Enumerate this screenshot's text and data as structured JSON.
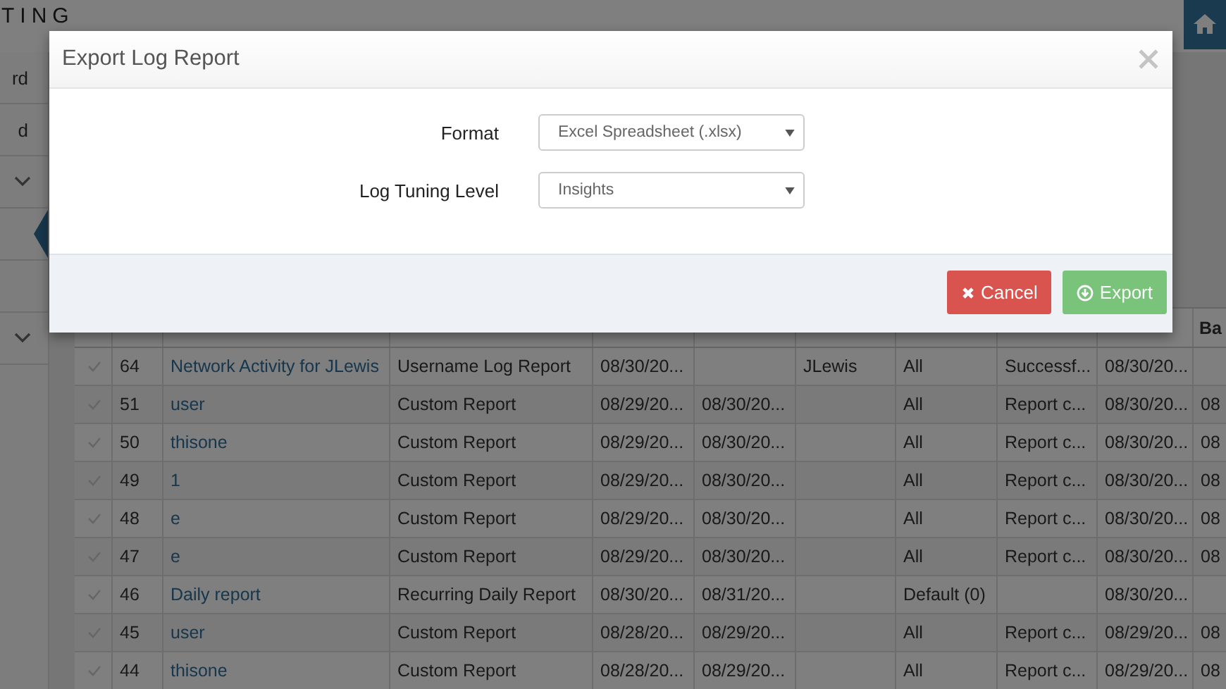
{
  "page_heading": "TING",
  "sidebar": {
    "items": [
      {
        "kind": "text",
        "label": "rd"
      },
      {
        "kind": "text",
        "label": "d"
      },
      {
        "kind": "chevron"
      },
      {
        "kind": "pointer"
      },
      {
        "kind": "blank"
      },
      {
        "kind": "chevron"
      }
    ]
  },
  "table": {
    "header_fragment": "Ba",
    "rows": [
      {
        "column_2": "64",
        "column_3": "Network Activity for JLewis",
        "column_4": "Username Log Report",
        "column_5": "08/30/20...",
        "column_7": "JLewis",
        "column_8": "All",
        "column_9": "Successf...",
        "column_10": "08/30/20..."
      },
      {
        "column_2": "51",
        "column_3": "user",
        "column_4": "Custom Report",
        "column_5": "08/29/20...",
        "column_6": "08/30/20...",
        "column_8": "All",
        "column_9": "Report c...",
        "column_10": "08/30/20...",
        "column_11": "08"
      },
      {
        "column_2": "50",
        "column_3": "thisone",
        "column_4": "Custom Report",
        "column_5": "08/29/20...",
        "column_6": "08/30/20...",
        "column_8": "All",
        "column_9": "Report c...",
        "column_10": "08/30/20...",
        "column_11": "08"
      },
      {
        "column_2": "49",
        "column_3": "1",
        "column_4": "Custom Report",
        "column_5": "08/29/20...",
        "column_6": "08/30/20...",
        "column_8": "All",
        "column_9": "Report c...",
        "column_10": "08/30/20...",
        "column_11": "08"
      },
      {
        "column_2": "48",
        "column_3": "e",
        "column_4": "Custom Report",
        "column_5": "08/29/20...",
        "column_6": "08/30/20...",
        "column_8": "All",
        "column_9": "Report c...",
        "column_10": "08/30/20...",
        "column_11": "08"
      },
      {
        "column_2": "47",
        "column_3": "e",
        "column_4": "Custom Report",
        "column_5": "08/29/20...",
        "column_6": "08/30/20...",
        "column_8": "All",
        "column_9": "Report c...",
        "column_10": "08/30/20...",
        "column_11": "08"
      },
      {
        "column_2": "46",
        "column_3": "Daily report",
        "column_4": "Recurring Daily Report",
        "column_5": "08/30/20...",
        "column_6": "08/31/20...",
        "column_8": "Default (0)",
        "column_10": "08/30/20..."
      },
      {
        "column_2": "45",
        "column_3": "user",
        "column_4": "Custom Report",
        "column_5": "08/28/20...",
        "column_6": "08/29/20...",
        "column_8": "All",
        "column_9": "Report c...",
        "column_10": "08/29/20...",
        "column_11": "08"
      },
      {
        "column_2": "44",
        "column_3": "thisone",
        "column_4": "Custom Report",
        "column_5": "08/28/20...",
        "column_6": "08/29/20...",
        "column_8": "All",
        "column_9": "Report c...",
        "column_10": "08/29/20...",
        "column_11": "08"
      }
    ]
  },
  "dialog": {
    "title": "Export Log Report",
    "fields": [
      {
        "label": "Format",
        "value": "Excel Spreadsheet (.xlsx)"
      },
      {
        "label": "Log Tuning Level",
        "value": "Insights"
      }
    ],
    "buttons": [
      {
        "kind": "cancel",
        "label": "Cancel",
        "disabled": false
      },
      {
        "kind": "export",
        "label": "Export",
        "disabled": true
      }
    ]
  }
}
